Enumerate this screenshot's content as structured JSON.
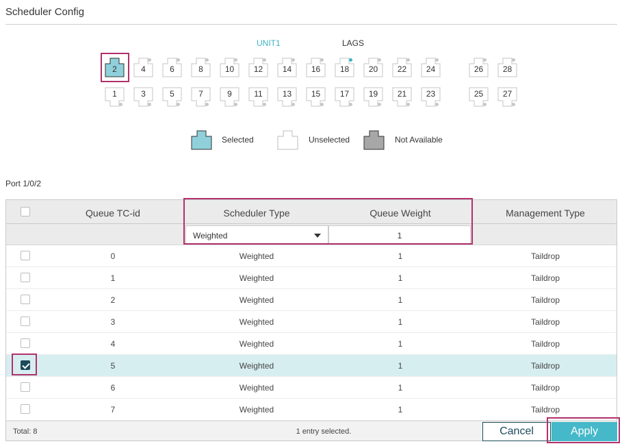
{
  "page": {
    "title": "Scheduler Config"
  },
  "tabs": {
    "unit": "UNIT1",
    "lags": "LAGS"
  },
  "ports": {
    "top": [
      {
        "label": "2",
        "state": "selected"
      },
      {
        "label": "4",
        "state": "unselected"
      },
      {
        "label": "6",
        "state": "unselected"
      },
      {
        "label": "8",
        "state": "unselected"
      },
      {
        "label": "10",
        "state": "unselected"
      },
      {
        "label": "12",
        "state": "unselected"
      },
      {
        "label": "14",
        "state": "unselected"
      },
      {
        "label": "16",
        "state": "unselected"
      },
      {
        "label": "18",
        "state": "unselected",
        "link": true
      },
      {
        "label": "20",
        "state": "unselected"
      },
      {
        "label": "22",
        "state": "unselected"
      },
      {
        "label": "24",
        "state": "unselected"
      },
      {
        "label": "26",
        "state": "unselected"
      },
      {
        "label": "28",
        "state": "unselected"
      }
    ],
    "bottom": [
      {
        "label": "1",
        "state": "unselected"
      },
      {
        "label": "3",
        "state": "unselected"
      },
      {
        "label": "5",
        "state": "unselected"
      },
      {
        "label": "7",
        "state": "unselected"
      },
      {
        "label": "9",
        "state": "unselected"
      },
      {
        "label": "11",
        "state": "unselected"
      },
      {
        "label": "13",
        "state": "unselected"
      },
      {
        "label": "15",
        "state": "unselected"
      },
      {
        "label": "17",
        "state": "unselected"
      },
      {
        "label": "19",
        "state": "unselected"
      },
      {
        "label": "21",
        "state": "unselected"
      },
      {
        "label": "23",
        "state": "unselected"
      },
      {
        "label": "25",
        "state": "unselected"
      },
      {
        "label": "27",
        "state": "unselected"
      }
    ]
  },
  "legend": {
    "selected": "Selected",
    "unselected": "Unselected",
    "not_available": "Not Available"
  },
  "colors": {
    "accent": "#3cb4c4",
    "selected_port": "#8fd0db",
    "not_available_port": "#a7a7a7",
    "highlight": "#b0306a",
    "apply": "#45b9c9",
    "dark": "#1c4b5b"
  },
  "port_label": "Port 1/0/2",
  "table": {
    "headers": {
      "queue": "Queue TC-id",
      "scheduler": "Scheduler Type",
      "weight": "Queue Weight",
      "management": "Management Type"
    },
    "filter": {
      "scheduler_value": "Weighted",
      "weight_value": "1"
    },
    "rows": [
      {
        "id": "0",
        "type": "Weighted",
        "weight": "1",
        "mgmt": "Taildrop",
        "checked": false
      },
      {
        "id": "1",
        "type": "Weighted",
        "weight": "1",
        "mgmt": "Taildrop",
        "checked": false
      },
      {
        "id": "2",
        "type": "Weighted",
        "weight": "1",
        "mgmt": "Taildrop",
        "checked": false
      },
      {
        "id": "3",
        "type": "Weighted",
        "weight": "1",
        "mgmt": "Taildrop",
        "checked": false
      },
      {
        "id": "4",
        "type": "Weighted",
        "weight": "1",
        "mgmt": "Taildrop",
        "checked": false
      },
      {
        "id": "5",
        "type": "Weighted",
        "weight": "1",
        "mgmt": "Taildrop",
        "checked": true
      },
      {
        "id": "6",
        "type": "Weighted",
        "weight": "1",
        "mgmt": "Taildrop",
        "checked": false
      },
      {
        "id": "7",
        "type": "Weighted",
        "weight": "1",
        "mgmt": "Taildrop",
        "checked": false
      }
    ],
    "footer": {
      "total": "Total: 8",
      "entry": "1 entry selected.",
      "cancel": "Cancel",
      "apply": "Apply"
    }
  }
}
